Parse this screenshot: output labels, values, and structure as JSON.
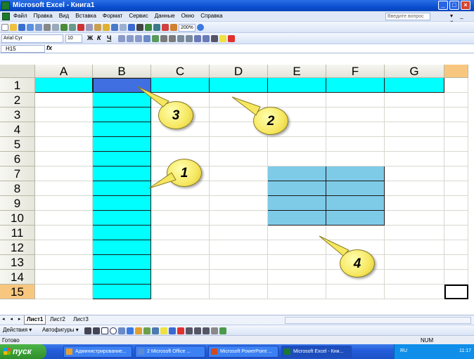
{
  "window": {
    "title": "Microsoft Excel - Книга1"
  },
  "menu": {
    "items": [
      "Файл",
      "Правка",
      "Вид",
      "Вставка",
      "Формат",
      "Сервис",
      "Данные",
      "Окно",
      "Справка"
    ],
    "help_placeholder": "Введите вопрос"
  },
  "toolbar": {
    "zoom": "200%",
    "font_name": "Arial Cyr",
    "font_size": "10",
    "bold": "Ж",
    "italic": "К",
    "underline": "Ч"
  },
  "formula_bar": {
    "name_box": "H15",
    "fx": "fx"
  },
  "columns": [
    "A",
    "B",
    "C",
    "D",
    "E",
    "F",
    "G"
  ],
  "rows": [
    "1",
    "2",
    "3",
    "4",
    "5",
    "6",
    "7",
    "8",
    "9",
    "10",
    "11",
    "12",
    "13",
    "14",
    "15"
  ],
  "callouts": {
    "c1": "1",
    "c2": "2",
    "c3": "3",
    "c4": "4"
  },
  "sheet_tabs": {
    "nav": "◂ ◂ ▸ ▸",
    "tab1": "Лист1",
    "tab2": "Лист2",
    "tab3": "Лист3"
  },
  "drawing_toolbar": {
    "actions": "Действия ▾",
    "autoshapes": "Автофигуры ▾"
  },
  "status": {
    "ready": "Готово",
    "num": "NUM"
  },
  "taskbar": {
    "start": "пуск",
    "tasks": [
      "Администрирование...",
      "2 Microsoft Office ...",
      "Microsoft PowerPoint ...",
      "Microsoft Excel - Кни..."
    ],
    "lang": "RU",
    "clock": "11:17"
  },
  "colors": {
    "cyan": "#00ffff",
    "selected_blue": "#3f6fe0",
    "range_sky": "#7ecbe8",
    "callout_yellow": "#f6e760"
  }
}
